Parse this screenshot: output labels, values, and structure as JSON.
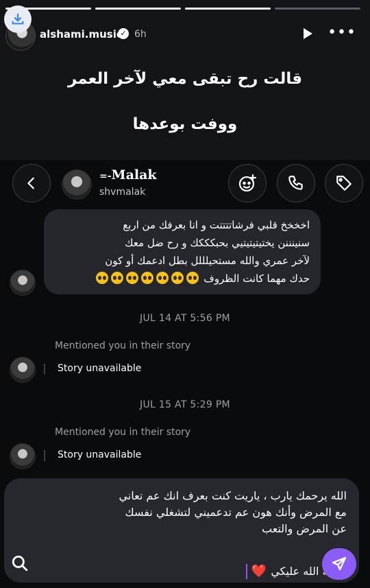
{
  "story": {
    "username": "alshami.music",
    "time": "6h",
    "caption_line1": "قالت رح تبقى معي لآخر العمر",
    "caption_line2": "ووفت بوعدها",
    "progress": [
      1,
      1,
      1,
      0
    ]
  },
  "chat": {
    "name": "Malak",
    "handle": "shvmalak",
    "message_lines": [
      "اخخخخ قلبي فرشاتتتتت و انا بعرفك من اربع",
      "سنينننن يختيتيتيتيي بحبكككك و رح ضل معك",
      "لآخر عمري والله مستحيلللل بطل ادعمك أو كون",
      "حدك مهما كانت الظروف"
    ],
    "emoji_count": 7,
    "events": [
      {
        "timestamp": "JUL 14 AT 5:56 PM",
        "mention": "Mentioned you in their story",
        "story": "Story unavailable"
      },
      {
        "timestamp": "JUL 15 AT 5:29 PM",
        "mention": "Mentioned you in their story",
        "story": "Story unavailable"
      }
    ]
  },
  "reply": {
    "lines": [
      "الله يرحمك يارب ، ياريت كنت بعرف انك عم تعاني",
      "مع المرض وأنك هون عم تدعميني لتشغلي نفسك",
      "عن المرض والتعب"
    ],
    "signature": "رحمة الله عليكي",
    "heart": "❤️"
  },
  "colors": {
    "accent": "#8b5cf6",
    "bubble": "#24262b",
    "background": "#121418"
  },
  "icons": [
    "download-icon",
    "verified-icon",
    "play-icon",
    "more-icon",
    "back-icon",
    "sticker-icon",
    "call-icon",
    "tag-icon",
    "search-icon",
    "send-icon"
  ]
}
